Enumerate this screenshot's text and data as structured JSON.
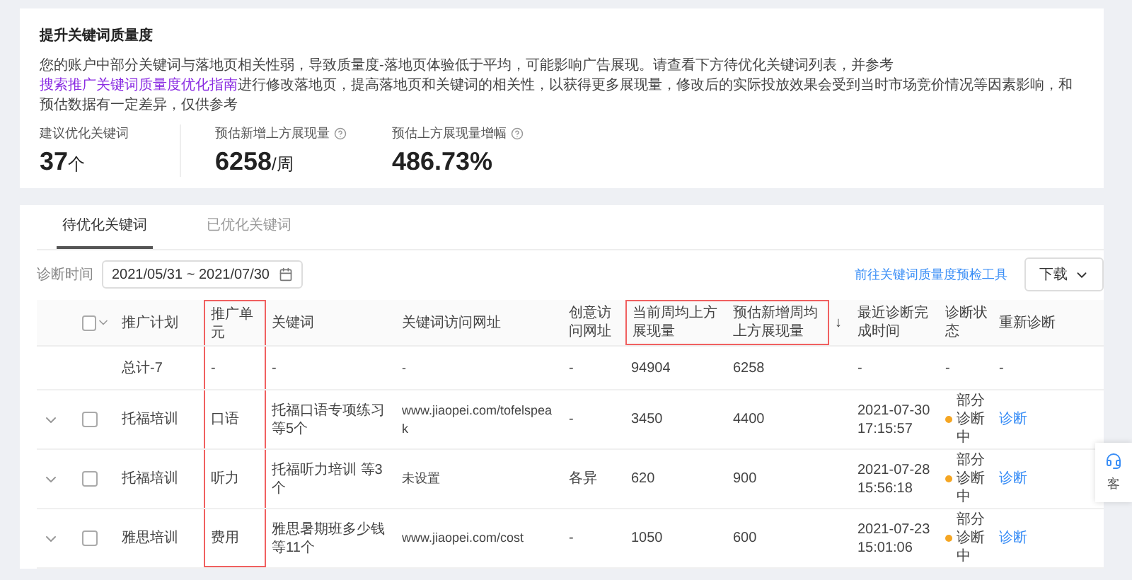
{
  "notice": {
    "title": "提升关键词质量度",
    "text_before": "您的账户中部分关键词与落地页相关性弱，导致质量度-落地页体验低于平均，可能影响广告展现。请查看下方待优化关键词列表，并参考",
    "link": "搜索推广关键词质量度优化指南",
    "text_after": "进行修改落地页，提高落地页和关键词的相关性，以获得更多展现量，修改后的实际投放效果会受到当时市场竞价情况等因素影响，和预估数据有一定差异，仅供参考"
  },
  "stats": [
    {
      "label": "建议优化关键词",
      "value": "37",
      "unit": "个",
      "help": false
    },
    {
      "label": "预估新增上方展现量",
      "value": "6258",
      "unit": "/周",
      "help": true
    },
    {
      "label": "预估上方展现量增幅",
      "value": "486.73%",
      "help": true
    }
  ],
  "tabs": [
    {
      "label": "待优化关键词",
      "selected": true
    },
    {
      "label": "已优化关键词",
      "selected": false
    }
  ],
  "filter": {
    "label": "诊断时间",
    "date_range": "2021/05/31 ~ 2021/07/30"
  },
  "tool_link": "前往关键词质量度预检工具",
  "download_button": "下载",
  "table": {
    "columns": [
      {
        "kind": "expand"
      },
      {
        "kind": "select",
        "checked": false
      },
      {
        "kind": "text",
        "label": "推广计划"
      },
      {
        "kind": "text",
        "label": "推广单元",
        "outlined": true
      },
      {
        "kind": "text",
        "label": "关键词"
      },
      {
        "kind": "text",
        "label": "关键词访问网址"
      },
      {
        "kind": "text",
        "label": "创意访问网址"
      },
      {
        "kind": "text",
        "label": "当前周均上方展现量",
        "header_outlined": true
      },
      {
        "kind": "text",
        "label": "预估新增周均上方展现量",
        "header_outlined": true
      },
      {
        "kind": "sort",
        "label": "↓"
      },
      {
        "kind": "text",
        "label": "最近诊断完成时间"
      },
      {
        "kind": "status",
        "label": "诊断状态"
      },
      {
        "kind": "action",
        "label": "重新诊断"
      }
    ],
    "rows": [
      {
        "kind": "total",
        "cells": [
          "",
          "",
          "总计-7",
          "-",
          "-",
          "-",
          "-",
          "94904",
          "6258",
          "",
          "-",
          "-",
          "-"
        ]
      },
      {
        "kind": "data",
        "expanded": false,
        "checked": false,
        "color": "#f5a623",
        "cells": [
          "",
          "",
          "托福培训",
          "口语",
          "托福口语专项练习等5个",
          "www.jiaopei.com/tofelspeak",
          "-",
          "3450",
          "4400",
          "",
          "2021-07-30 17:15:57",
          "部分诊断中",
          "诊断"
        ]
      },
      {
        "kind": "data",
        "expanded": false,
        "checked": false,
        "color": "#f5a623",
        "cells": [
          "",
          "",
          "托福培训",
          "听力",
          "托福听力培训 等3个",
          "未设置",
          "各异",
          "620",
          "900",
          "",
          "2021-07-28 15:56:18",
          "部分诊断中",
          "诊断"
        ]
      },
      {
        "kind": "data",
        "expanded": false,
        "checked": false,
        "color": "#f5a623",
        "cells": [
          "",
          "",
          "雅思培训",
          "费用",
          "雅思暑期班多少钱等11个",
          "www.jiaopei.com/cost",
          "-",
          "1050",
          "600",
          "",
          "2021-07-23 15:01:06",
          "部分诊断中",
          "诊断"
        ]
      }
    ]
  },
  "side_widget": {
    "label": "客"
  }
}
